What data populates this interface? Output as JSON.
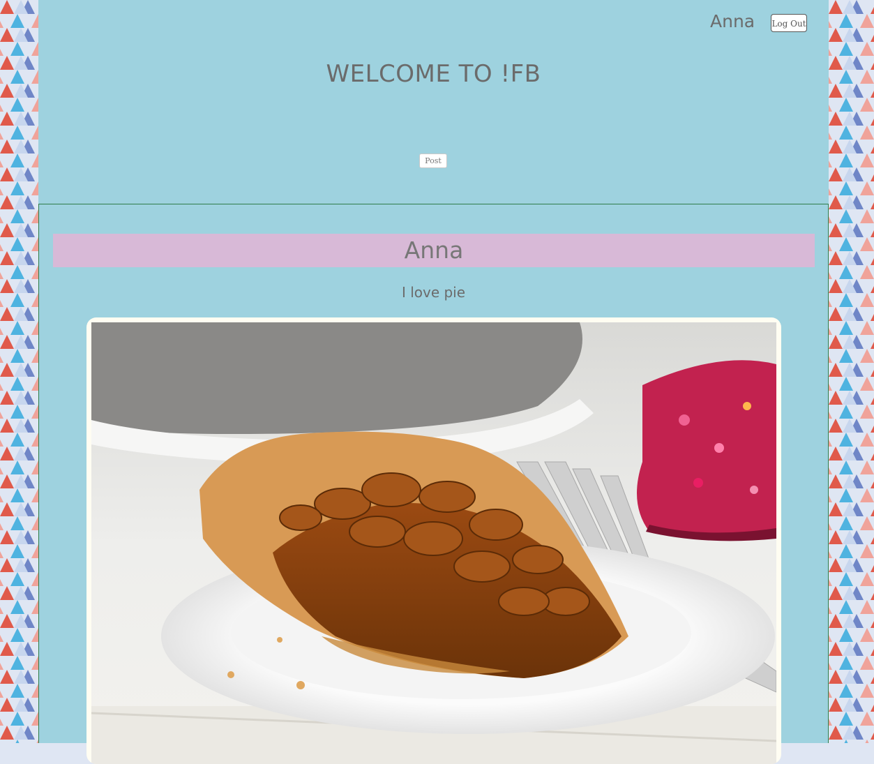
{
  "header": {
    "user_name": "Anna",
    "logout_label": "Log Out",
    "welcome_title": "WELCOME TO !FB",
    "post_button_label": "Post"
  },
  "feed": {
    "posts": [
      {
        "author": "Anna",
        "text": "I love pie",
        "image": "pecan-pie-photo"
      }
    ]
  },
  "colors": {
    "main_background": "#9ed2df",
    "author_bar": "#d8b9d7",
    "feed_border": "#2f7d4a",
    "text": "#6b6b6b"
  }
}
